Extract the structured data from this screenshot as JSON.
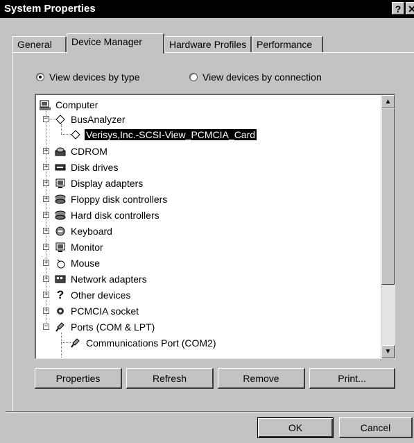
{
  "window": {
    "title": "System Properties",
    "help_label": "?",
    "close_label": "✕"
  },
  "tabs": [
    {
      "label": "General"
    },
    {
      "label": "Device Manager"
    },
    {
      "label": "Hardware Profiles"
    },
    {
      "label": "Performance"
    }
  ],
  "view_options": {
    "by_type": "View devices by type",
    "by_connection": "View devices by connection",
    "selected": "by_type"
  },
  "tree": {
    "items": [
      {
        "label": "Computer",
        "icon": "computer-icon",
        "level": 0,
        "expander": "none"
      },
      {
        "label": "BusAnalyzer",
        "icon": "diamond-icon",
        "level": 1,
        "expander": "minus"
      },
      {
        "label": "Verisys,Inc.-SCSI-View_PCMCIA_Card",
        "icon": "diamond-icon",
        "level": 2,
        "expander": "none",
        "selected": true
      },
      {
        "label": "CDROM",
        "icon": "cdrom-icon",
        "level": 1,
        "expander": "plus"
      },
      {
        "label": "Disk drives",
        "icon": "disk-drive-icon",
        "level": 1,
        "expander": "plus"
      },
      {
        "label": "Display adapters",
        "icon": "monitor-icon",
        "level": 1,
        "expander": "plus"
      },
      {
        "label": "Floppy disk controllers",
        "icon": "controller-icon",
        "level": 1,
        "expander": "plus"
      },
      {
        "label": "Hard disk controllers",
        "icon": "controller-icon",
        "level": 1,
        "expander": "plus"
      },
      {
        "label": "Keyboard",
        "icon": "keyboard-icon",
        "level": 1,
        "expander": "plus"
      },
      {
        "label": "Monitor",
        "icon": "monitor-icon",
        "level": 1,
        "expander": "plus"
      },
      {
        "label": "Mouse",
        "icon": "mouse-icon",
        "level": 1,
        "expander": "plus"
      },
      {
        "label": "Network adapters",
        "icon": "network-icon",
        "level": 1,
        "expander": "plus"
      },
      {
        "label": "Other devices",
        "icon": "question-icon",
        "level": 1,
        "expander": "plus"
      },
      {
        "label": "PCMCIA socket",
        "icon": "pcmcia-icon",
        "level": 1,
        "expander": "plus"
      },
      {
        "label": "Ports (COM & LPT)",
        "icon": "port-icon",
        "level": 1,
        "expander": "minus"
      },
      {
        "label": "Communications Port (COM2)",
        "icon": "port-icon",
        "level": 2,
        "expander": "none"
      }
    ]
  },
  "buttons": {
    "properties": "Properties",
    "refresh": "Refresh",
    "remove": "Remove",
    "print": "Print...",
    "ok": "OK",
    "cancel": "Cancel"
  },
  "scrollbar": {
    "up": "▲",
    "down": "▼"
  },
  "colors": {
    "titlebar": "#000000",
    "face": "#c3c3c3",
    "selection": "#000000"
  }
}
